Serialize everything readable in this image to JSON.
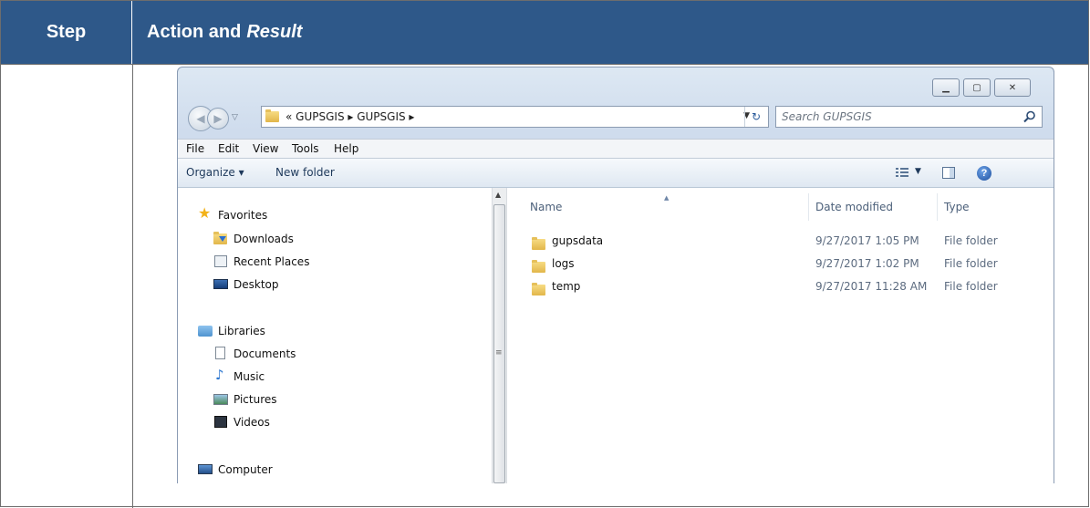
{
  "doc_header": {
    "step_label": "Step",
    "action_label": "Action and",
    "result_label": "Result"
  },
  "window": {
    "controls": {
      "minimize_icon": "minimize-icon",
      "maximize_icon": "maximize-icon",
      "close_icon": "close-icon"
    },
    "address": {
      "chevron": "«",
      "crumbs": "GUPSGIS  ▸  GUPSGIS  ▸"
    },
    "search_placeholder": "Search GUPSGIS",
    "menu": [
      "File",
      "Edit",
      "View",
      "Tools",
      "Help"
    ],
    "commands": {
      "organize": "Organize ▾",
      "new_folder": "New folder"
    }
  },
  "nav_pane": {
    "favorites": {
      "label": "Favorites",
      "items": [
        "Downloads",
        "Recent Places",
        "Desktop"
      ]
    },
    "libraries": {
      "label": "Libraries",
      "items": [
        "Documents",
        "Music",
        "Pictures",
        "Videos"
      ]
    },
    "computer": {
      "label": "Computer"
    }
  },
  "file_list": {
    "columns": [
      "Name",
      "Date modified",
      "Type"
    ],
    "rows": [
      {
        "name": "gupsdata",
        "date": "9/27/2017 1:05 PM",
        "type": "File folder"
      },
      {
        "name": "logs",
        "date": "9/27/2017 1:02 PM",
        "type": "File folder"
      },
      {
        "name": "temp",
        "date": "9/27/2017 11:28 AM",
        "type": "File folder"
      }
    ]
  }
}
